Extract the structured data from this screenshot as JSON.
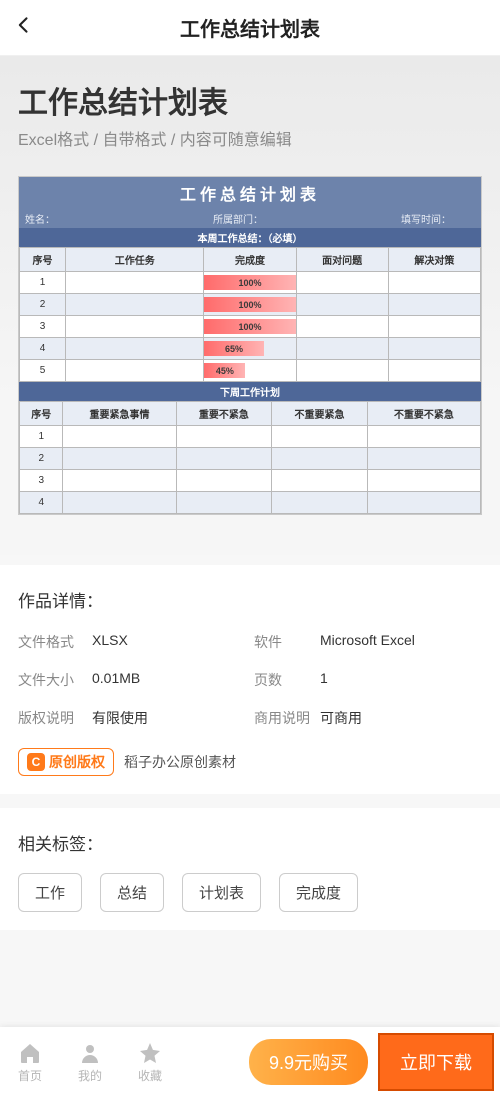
{
  "header": {
    "title": "工作总结计划表"
  },
  "preview": {
    "title": "工作总结计划表",
    "subtitle": "Excel格式 / 自带格式 / 内容可随意编辑",
    "sheet": {
      "title": "工作总结计划表",
      "meta": {
        "name_label": "姓名：",
        "dept_label": "所属部门：",
        "date_label": "填写时间："
      },
      "section1_title": "本周工作总结：（必填）",
      "tbl1_headers": [
        "序号",
        "工作任务",
        "完成度",
        "面对问题",
        "解决对策"
      ],
      "tbl1_rows": [
        {
          "seq": "1",
          "progress_text": "100%",
          "progress_pct": 100
        },
        {
          "seq": "2",
          "progress_text": "100%",
          "progress_pct": 100
        },
        {
          "seq": "3",
          "progress_text": "100%",
          "progress_pct": 100
        },
        {
          "seq": "4",
          "progress_text": "65%",
          "progress_pct": 65
        },
        {
          "seq": "5",
          "progress_text": "45%",
          "progress_pct": 45
        }
      ],
      "section2_title": "下周工作计划",
      "tbl2_headers": [
        "序号",
        "重要紧急事情",
        "重要不紧急",
        "不重要紧急",
        "不重要不紧急"
      ],
      "tbl2_rows": [
        "1",
        "2",
        "3",
        "4"
      ]
    }
  },
  "details": {
    "title": "作品详情：",
    "items": [
      {
        "label": "文件格式",
        "value": "XLSX"
      },
      {
        "label": "软件",
        "value": "Microsoft Excel"
      },
      {
        "label": "文件大小",
        "value": "0.01MB"
      },
      {
        "label": "页数",
        "value": "1"
      },
      {
        "label": "版权说明",
        "value": "有限使用"
      },
      {
        "label": "商用说明",
        "value": "可商用"
      }
    ],
    "original_badge": "原创版权",
    "original_text": "稻子办公原创素材"
  },
  "tags": {
    "title": "相关标签：",
    "items": [
      "工作",
      "总结",
      "计划表",
      "完成度"
    ]
  },
  "bottom": {
    "nav": [
      {
        "key": "home",
        "label": "首页"
      },
      {
        "key": "mine",
        "label": "我的"
      },
      {
        "key": "fav",
        "label": "收藏"
      }
    ],
    "buy": "9.9元购买",
    "download": "立即下载"
  }
}
